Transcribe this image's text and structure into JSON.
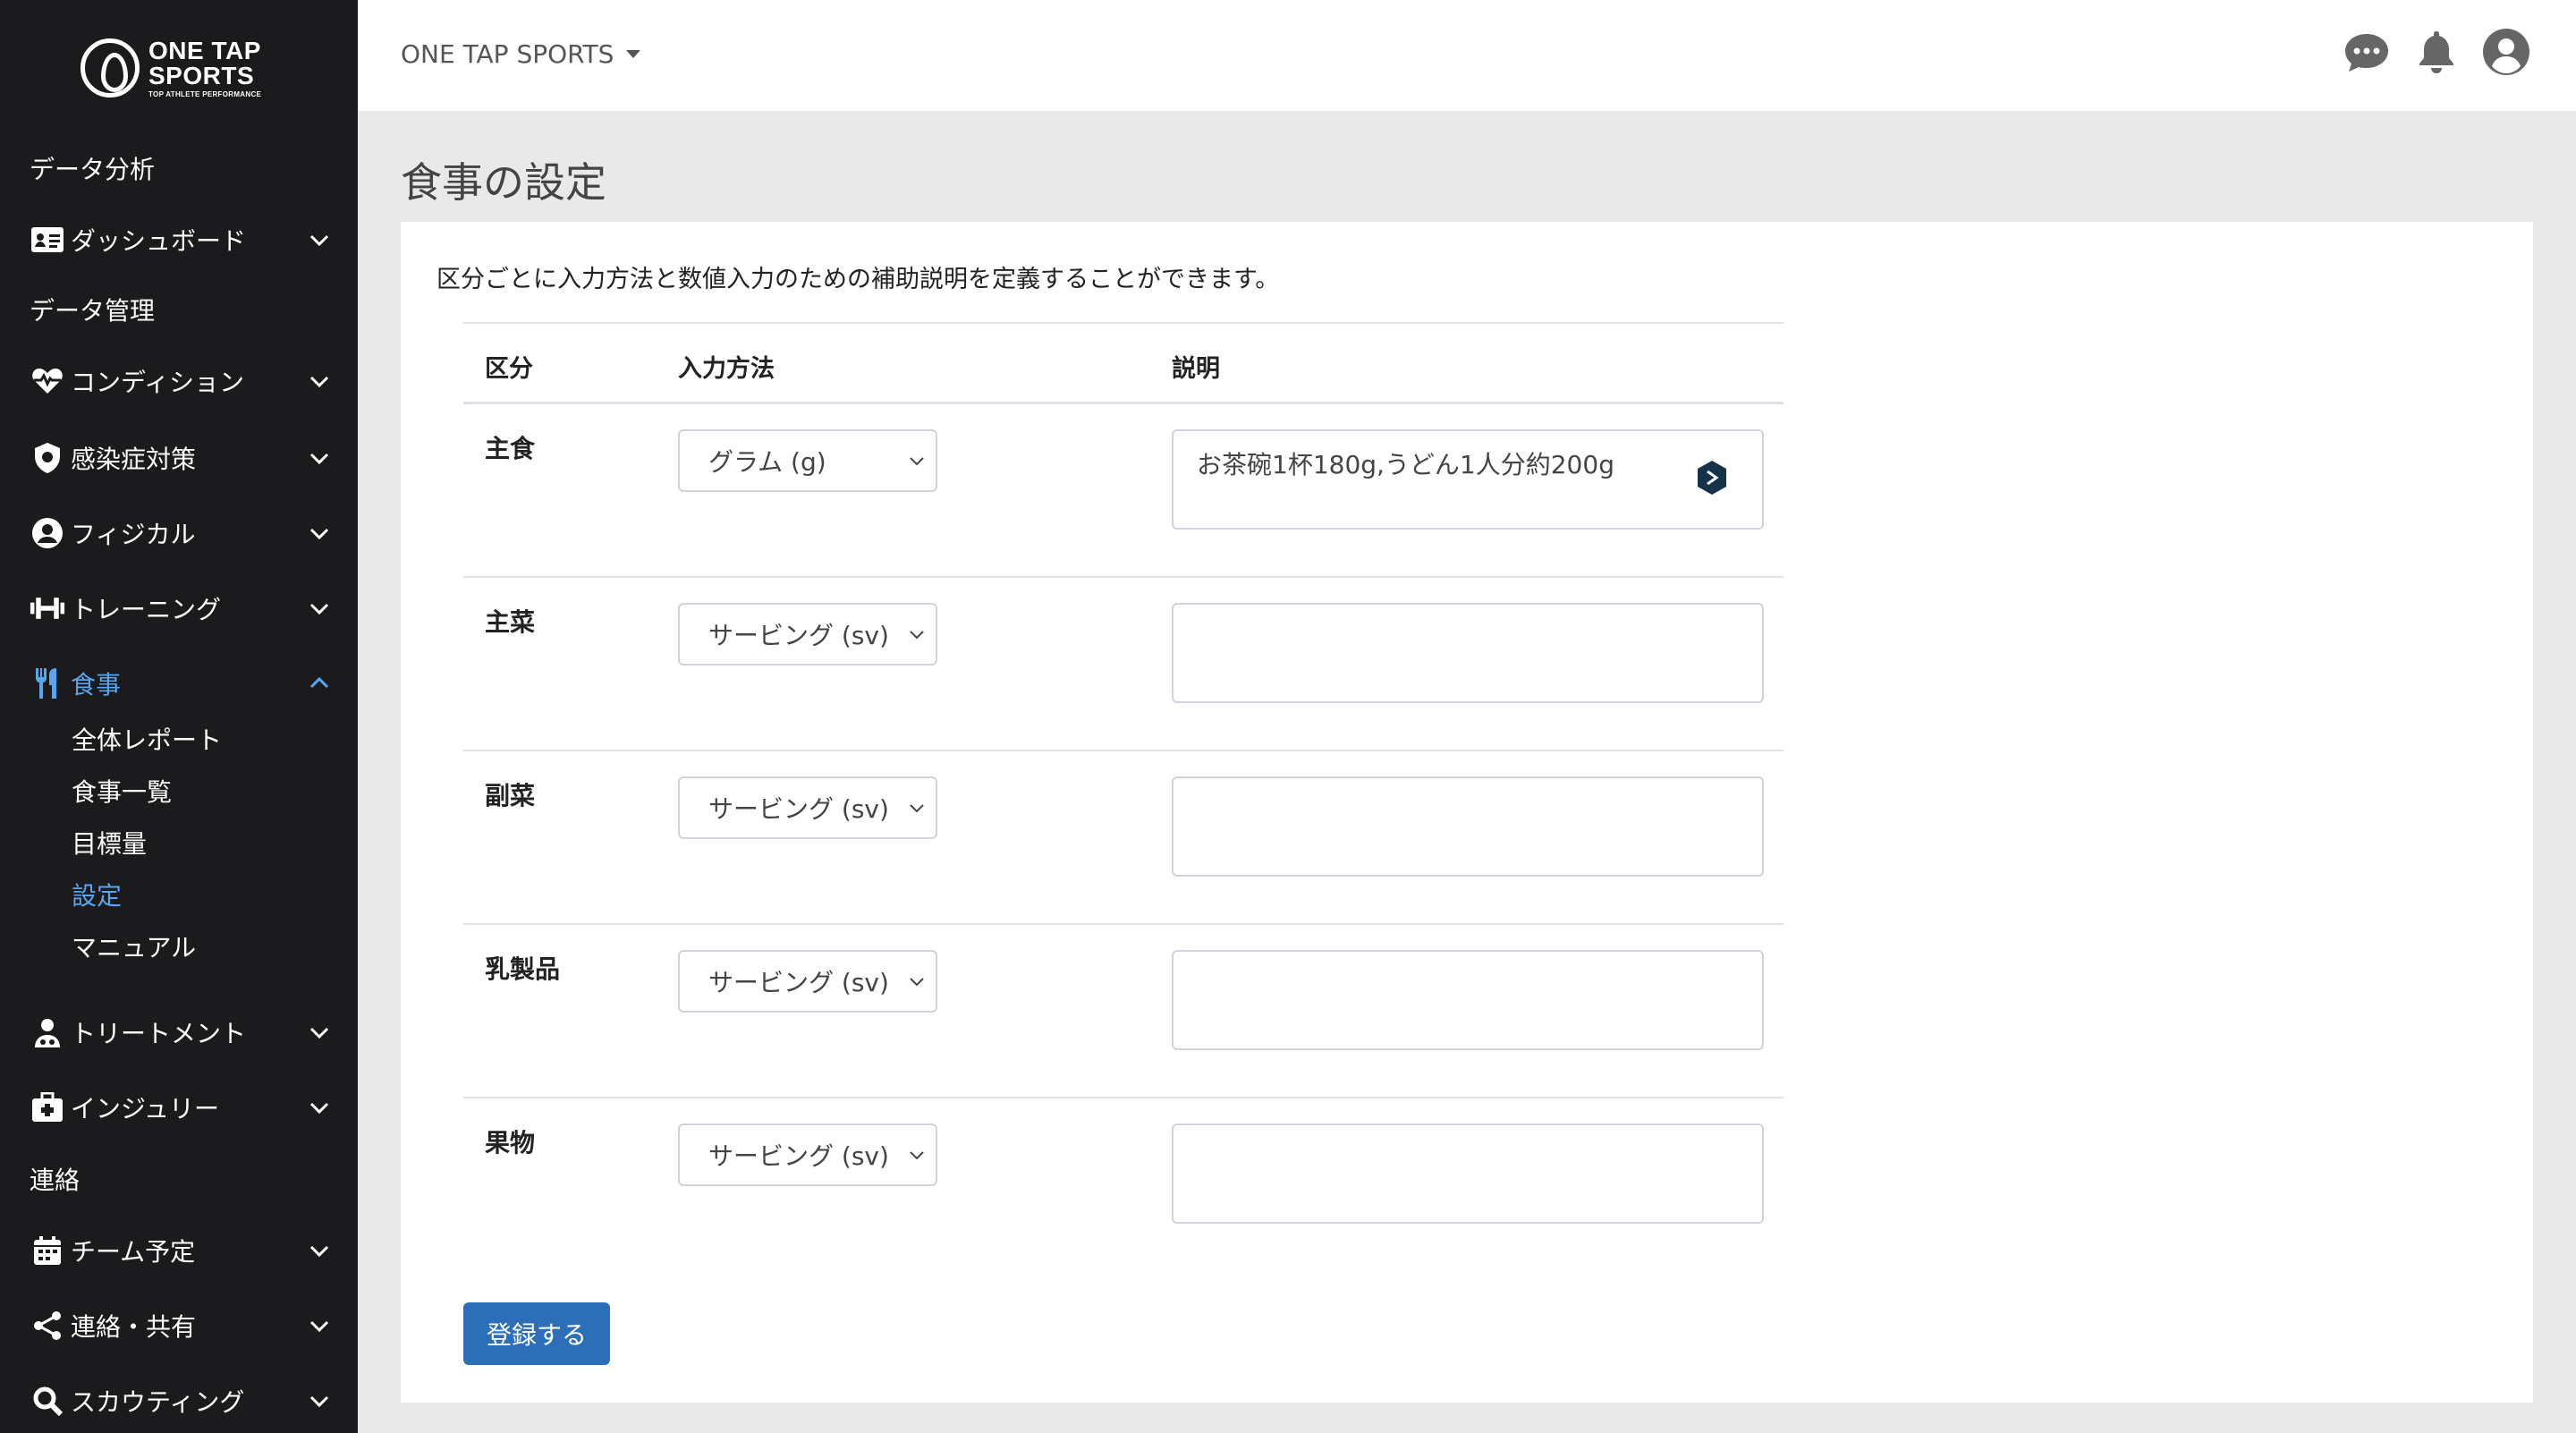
{
  "brand": {
    "line1": "ONE TAP",
    "line2": "SPORTS",
    "tagline": "TOP ATHLETE PERFORMANCE"
  },
  "sidebar": {
    "sections": [
      {
        "heading": "データ分析"
      },
      {
        "label": "ダッシュボード",
        "icon": "id-card-icon"
      },
      {
        "heading": "データ管理"
      },
      {
        "label": "コンディション",
        "icon": "heart-pulse-icon"
      },
      {
        "label": "感染症対策",
        "icon": "shield-virus-icon"
      },
      {
        "label": "フィジカル",
        "icon": "user-circle-icon"
      },
      {
        "label": "トレーニング",
        "icon": "dumbbell-icon"
      },
      {
        "label": "食事",
        "icon": "utensils-icon",
        "active": true
      },
      {
        "label": "トリートメント",
        "icon": "user-nurse-icon"
      },
      {
        "label": "インジュリー",
        "icon": "medkit-icon"
      },
      {
        "heading": "連絡"
      },
      {
        "label": "チーム予定",
        "icon": "calendar-icon"
      },
      {
        "label": "連絡・共有",
        "icon": "share-icon"
      },
      {
        "label": "スカウティング",
        "icon": "search-icon"
      }
    ],
    "meal_sub": [
      "全体レポート",
      "食事一覧",
      "目標量",
      "設定",
      "マニュアル"
    ],
    "meal_sub_active": "設定"
  },
  "topbar": {
    "team": "ONE TAP SPORTS",
    "icons": [
      "chat-icon",
      "bell-icon",
      "account-icon"
    ]
  },
  "page": {
    "title": "食事の設定",
    "description": "区分ごとに入力方法と数値入力のための補助説明を定義することができます。"
  },
  "table": {
    "headers": {
      "category": "区分",
      "method": "入力方法",
      "note": "説明"
    },
    "rows": [
      {
        "category": "主食",
        "method": "グラム (g)",
        "note": "お茶碗1杯180g,うどん1人分約200g"
      },
      {
        "category": "主菜",
        "method": "サービング (sv)",
        "note": ""
      },
      {
        "category": "副菜",
        "method": "サービング (sv)",
        "note": ""
      },
      {
        "category": "乳製品",
        "method": "サービング (sv)",
        "note": ""
      },
      {
        "category": "果物",
        "method": "サービング (sv)",
        "note": ""
      }
    ]
  },
  "actions": {
    "submit": "登録する"
  },
  "colors": {
    "sidebar_bg": "#1b1b1d",
    "accent": "#57a6f0",
    "primary_button": "#2c6fb8"
  }
}
